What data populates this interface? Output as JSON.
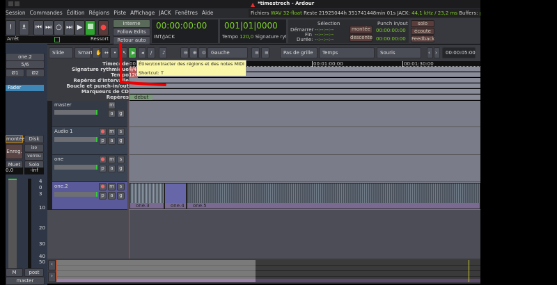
{
  "window": {
    "title": "*timestrech - Ardour"
  },
  "menu": [
    "Session",
    "Commandes",
    "Édition",
    "Régions",
    "Piste",
    "Affichage",
    "JACK",
    "Fenêtres",
    "Aide"
  ],
  "status": {
    "files_label": "Fichiers",
    "format": "WAV 32-float",
    "remaining": "Reste 21925044h 351741448min 01s",
    "jack_label": "JACK:",
    "jack_value": "44,1 kHz / 23,2 ms",
    "buffers_label": "Buffers:",
    "buffers_value": "p"
  },
  "transport": {
    "stop_label": "Arrêt",
    "spring_label": "Ressort",
    "interne": "Interne",
    "follow_edits": "Follow Edits",
    "retour_auto": "Retour auto",
    "timecode": "00:00:00:00",
    "sync_label": "INT/JACK",
    "bbt": "001|01|0000",
    "tempo_label": "Tempo",
    "tempo_value": "120,0",
    "signature_label": "Signature rythm"
  },
  "selection": {
    "title": "Sélection",
    "start_label": "Démarrer",
    "end_label": "Fin",
    "duration_label": "Durée:",
    "empty": "--:--:--:--",
    "up": "montée",
    "down": "descente",
    "punch_title": "Punch in/out",
    "punch_in": "00:00:00:00",
    "punch_out": "00:00:00:00"
  },
  "monitor": {
    "solo": "solo",
    "listen": "écoute",
    "feedback": "Feedback"
  },
  "editor_toolbar": {
    "edit_mode": "Slide",
    "smart": "Smart",
    "zoom_focus": "Gauche",
    "grid": "Pas de grille",
    "grid_type": "Temps",
    "edit_point": "Souris",
    "nudge_clock": "00:00:05:00"
  },
  "tooltip": {
    "text": "Étirer/contracter des régions et des notes MIDI",
    "shortcut": "Shortcut: T"
  },
  "rulers": {
    "labels": [
      "Timecode",
      "Signature rythmique",
      "Tempo",
      "Repères d'intervalle",
      "Boucle et punch-in/out",
      "Marqueurs de CD",
      "Repères"
    ],
    "tc_marks": [
      "00:01:00:00",
      "00:01:30:00"
    ],
    "sig": "4/4",
    "tempo": "120",
    "marker": "debut",
    "tc_start": "00"
  },
  "tracks": [
    {
      "name": "master",
      "buttons": [
        "m",
        "a",
        "g"
      ]
    },
    {
      "name": "Audio 1",
      "buttons": [
        "m",
        "s",
        "p",
        "a",
        "g"
      ]
    },
    {
      "name": "one",
      "buttons": [
        "m",
        "s",
        "p",
        "a",
        "g"
      ]
    },
    {
      "name": "one.2",
      "buttons": [
        "m",
        "s",
        "p",
        "a",
        "g"
      ]
    }
  ],
  "regions": [
    "one.3",
    "one.4",
    "one.5"
  ],
  "strip": {
    "name": "one.2",
    "io": "5/6",
    "phase1": "Ø1",
    "phase2": "Ø2",
    "fader": "Fader",
    "input": "montée",
    "disk": "Disk",
    "rec": "Enreg.",
    "iso": "iso",
    "lock": "verrou",
    "mute": "Muet",
    "solo": "Solo",
    "gain": "0.0",
    "peak": "-inf",
    "scale": [
      "4",
      "0",
      "3",
      "10",
      "20",
      "30",
      "40",
      "50"
    ],
    "meter_point": "post",
    "m": "M",
    "output": "master"
  }
}
